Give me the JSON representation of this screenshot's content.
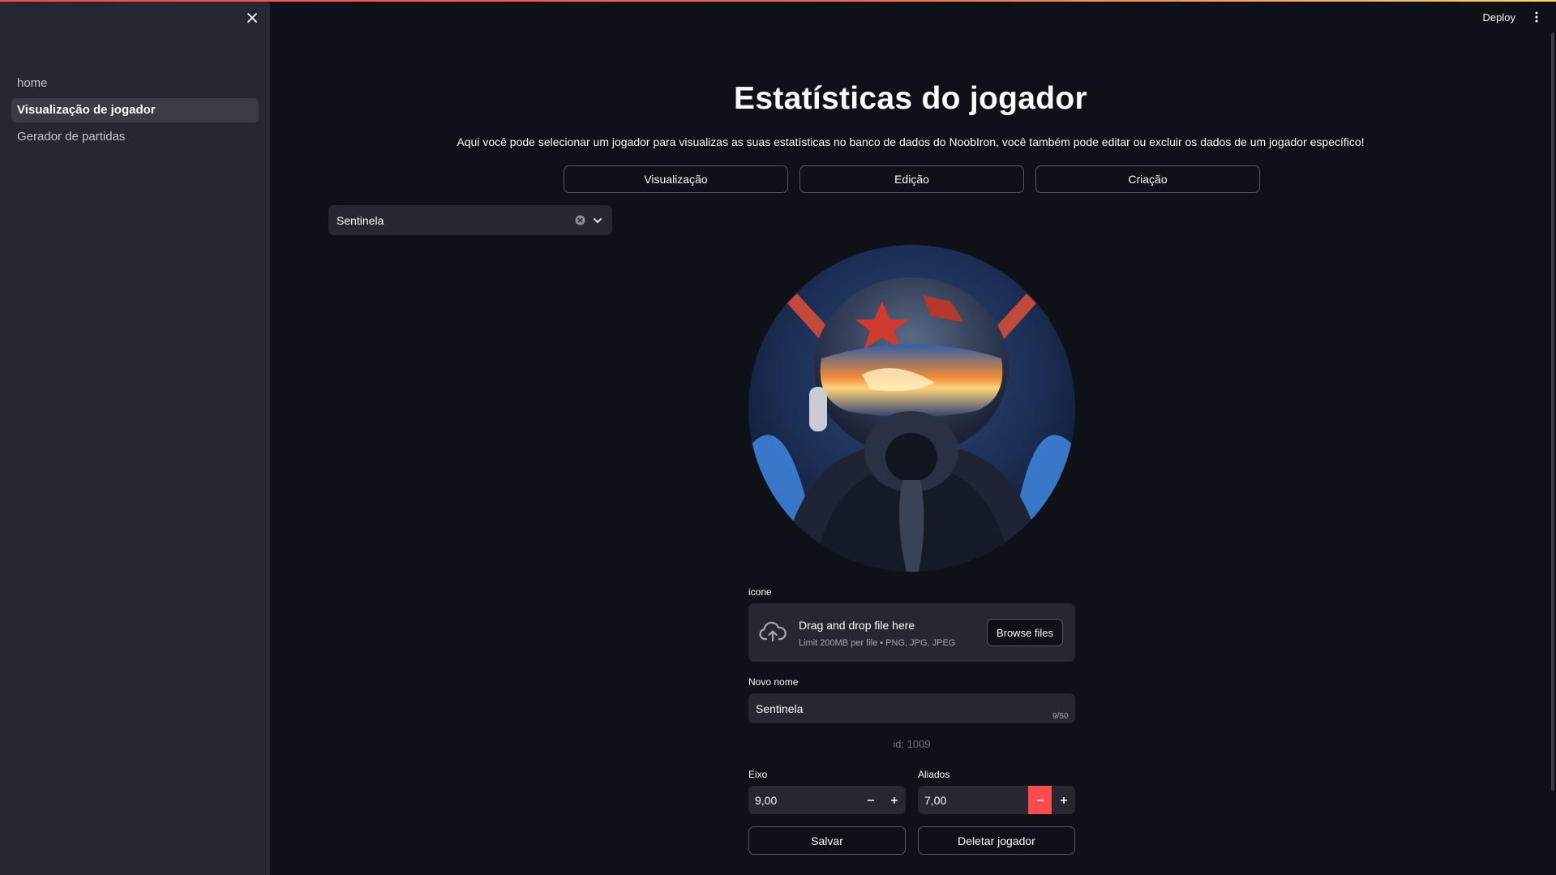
{
  "app": {
    "deploy_label": "Deploy",
    "accent_color": "#ff4b4b"
  },
  "sidebar": {
    "items": [
      {
        "label": "home",
        "active": false
      },
      {
        "label": "Visualização de jogador",
        "active": true
      },
      {
        "label": "Gerador de partidas",
        "active": false
      }
    ]
  },
  "main": {
    "title": "Estatísticas do jogador",
    "subtitle": "Aqui você pode selecionar um jogador para visualizas as suas estatísticas no banco de dados do NoobIron, você também pode editar ou excluir os dados de um jogador específico!",
    "tabs": [
      {
        "label": "Visualização"
      },
      {
        "label": "Edição"
      },
      {
        "label": "Criação"
      }
    ],
    "player_select": {
      "value": "Sentinela"
    },
    "uploader": {
      "label": "icone",
      "title": "Drag and drop file here",
      "hint": "Limit 200MB per file • PNG, JPG, JPEG",
      "browse_label": "Browse files"
    },
    "name_field": {
      "label": "Novo nome",
      "value": "Sentinela",
      "counter": "9/50"
    },
    "id_text": "id: 1009",
    "eixo": {
      "label": "Eixo",
      "value": "9,00"
    },
    "aliados": {
      "label": "Aliados",
      "value": "7,00"
    },
    "save_label": "Salvar",
    "delete_label": "Deletar jogador"
  }
}
